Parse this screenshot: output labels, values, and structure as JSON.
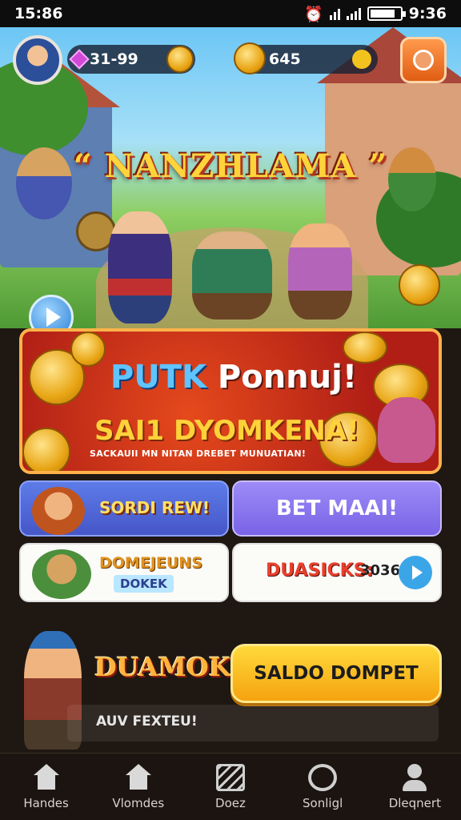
{
  "status_bar": {
    "time": "15:86",
    "battery_text": "9:36",
    "battery_level": 0.85
  },
  "hud": {
    "gems_value": "31-99",
    "coins_value": "645"
  },
  "hero": {
    "title": "“ NANZHLAMA ”"
  },
  "promo": {
    "title_part1": "PUTK",
    "title_part2": "Ponnuj!",
    "subtitle": "SAI1 DYOMKENA!",
    "note": "SACKAUII MN NITAN DREBET MUNUATIAN!"
  },
  "tiles": {
    "a_label": "SORDI REW!",
    "b_label": "BET MAAI!",
    "c_label_1": "DOMEJEUNS",
    "c_label_2": "DOKEK",
    "d_label_1": "DUASICKS:",
    "d_label_2": "3036"
  },
  "bottom": {
    "brand": "DUAMOKS",
    "cta_label": "SALDO DOMPET",
    "notice": "AUV FEXTEU!"
  },
  "nav": [
    {
      "label": "Handes",
      "icon": "home-icon"
    },
    {
      "label": "Vlomdes",
      "icon": "home-icon"
    },
    {
      "label": "Doez",
      "icon": "ticket-icon"
    },
    {
      "label": "Sonligl",
      "icon": "phone-icon"
    },
    {
      "label": "Dleqnert",
      "icon": "user-icon"
    }
  ]
}
